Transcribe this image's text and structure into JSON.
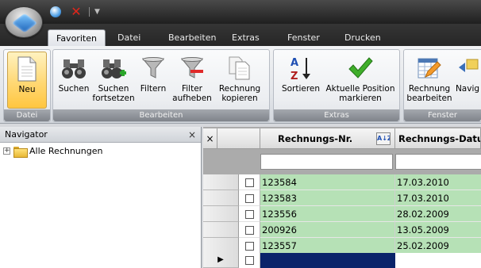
{
  "qat": {
    "save_icon": "disc-icon",
    "close_icon": "red-x-icon"
  },
  "tabs": [
    {
      "label": "Favoriten",
      "active": true
    },
    {
      "label": "Datei"
    },
    {
      "label": "Bearbeiten"
    },
    {
      "label": "Extras"
    },
    {
      "label": "Fenster"
    },
    {
      "label": "Drucken"
    }
  ],
  "ribbon": {
    "groups": {
      "datei": "Datei",
      "bearbeiten": "Bearbeiten",
      "extras": "Extras",
      "fenster": "Fenster"
    },
    "buttons": {
      "neu": "Neu",
      "suchen": "Suchen",
      "suchen_fortsetzen_1": "Suchen",
      "suchen_fortsetzen_2": "fortsetzen",
      "filtern": "Filtern",
      "filter_aufheben_1": "Filter",
      "filter_aufheben_2": "aufheben",
      "rechnung_kopieren_1": "Rechnung",
      "rechnung_kopieren_2": "kopieren",
      "sortieren": "Sortieren",
      "aktuelle_position_1": "Aktuelle Position",
      "aktuelle_position_2": "markieren",
      "rechnung_bearbeiten_1": "Rechnung",
      "rechnung_bearbeiten_2": "bearbeiten",
      "navig": "Navig"
    }
  },
  "navigator": {
    "title": "Navigator",
    "close": "×",
    "expand": "+",
    "tree_root": "Alle Rechnungen"
  },
  "grid": {
    "corner_glyph": "×",
    "columns": [
      "Rechnungs-Nr.",
      "Rechnungs-Datu"
    ],
    "sort_glyph": "A↓Z",
    "rows": [
      {
        "nr": "123584",
        "datum": "17.03.2010"
      },
      {
        "nr": "123583",
        "datum": "17.03.2010"
      },
      {
        "nr": "123556",
        "datum": "28.02.2009"
      },
      {
        "nr": "200926",
        "datum": "13.05.2009"
      },
      {
        "nr": "123557",
        "datum": "25.02.2009"
      }
    ],
    "new_row_marker": "▶"
  }
}
